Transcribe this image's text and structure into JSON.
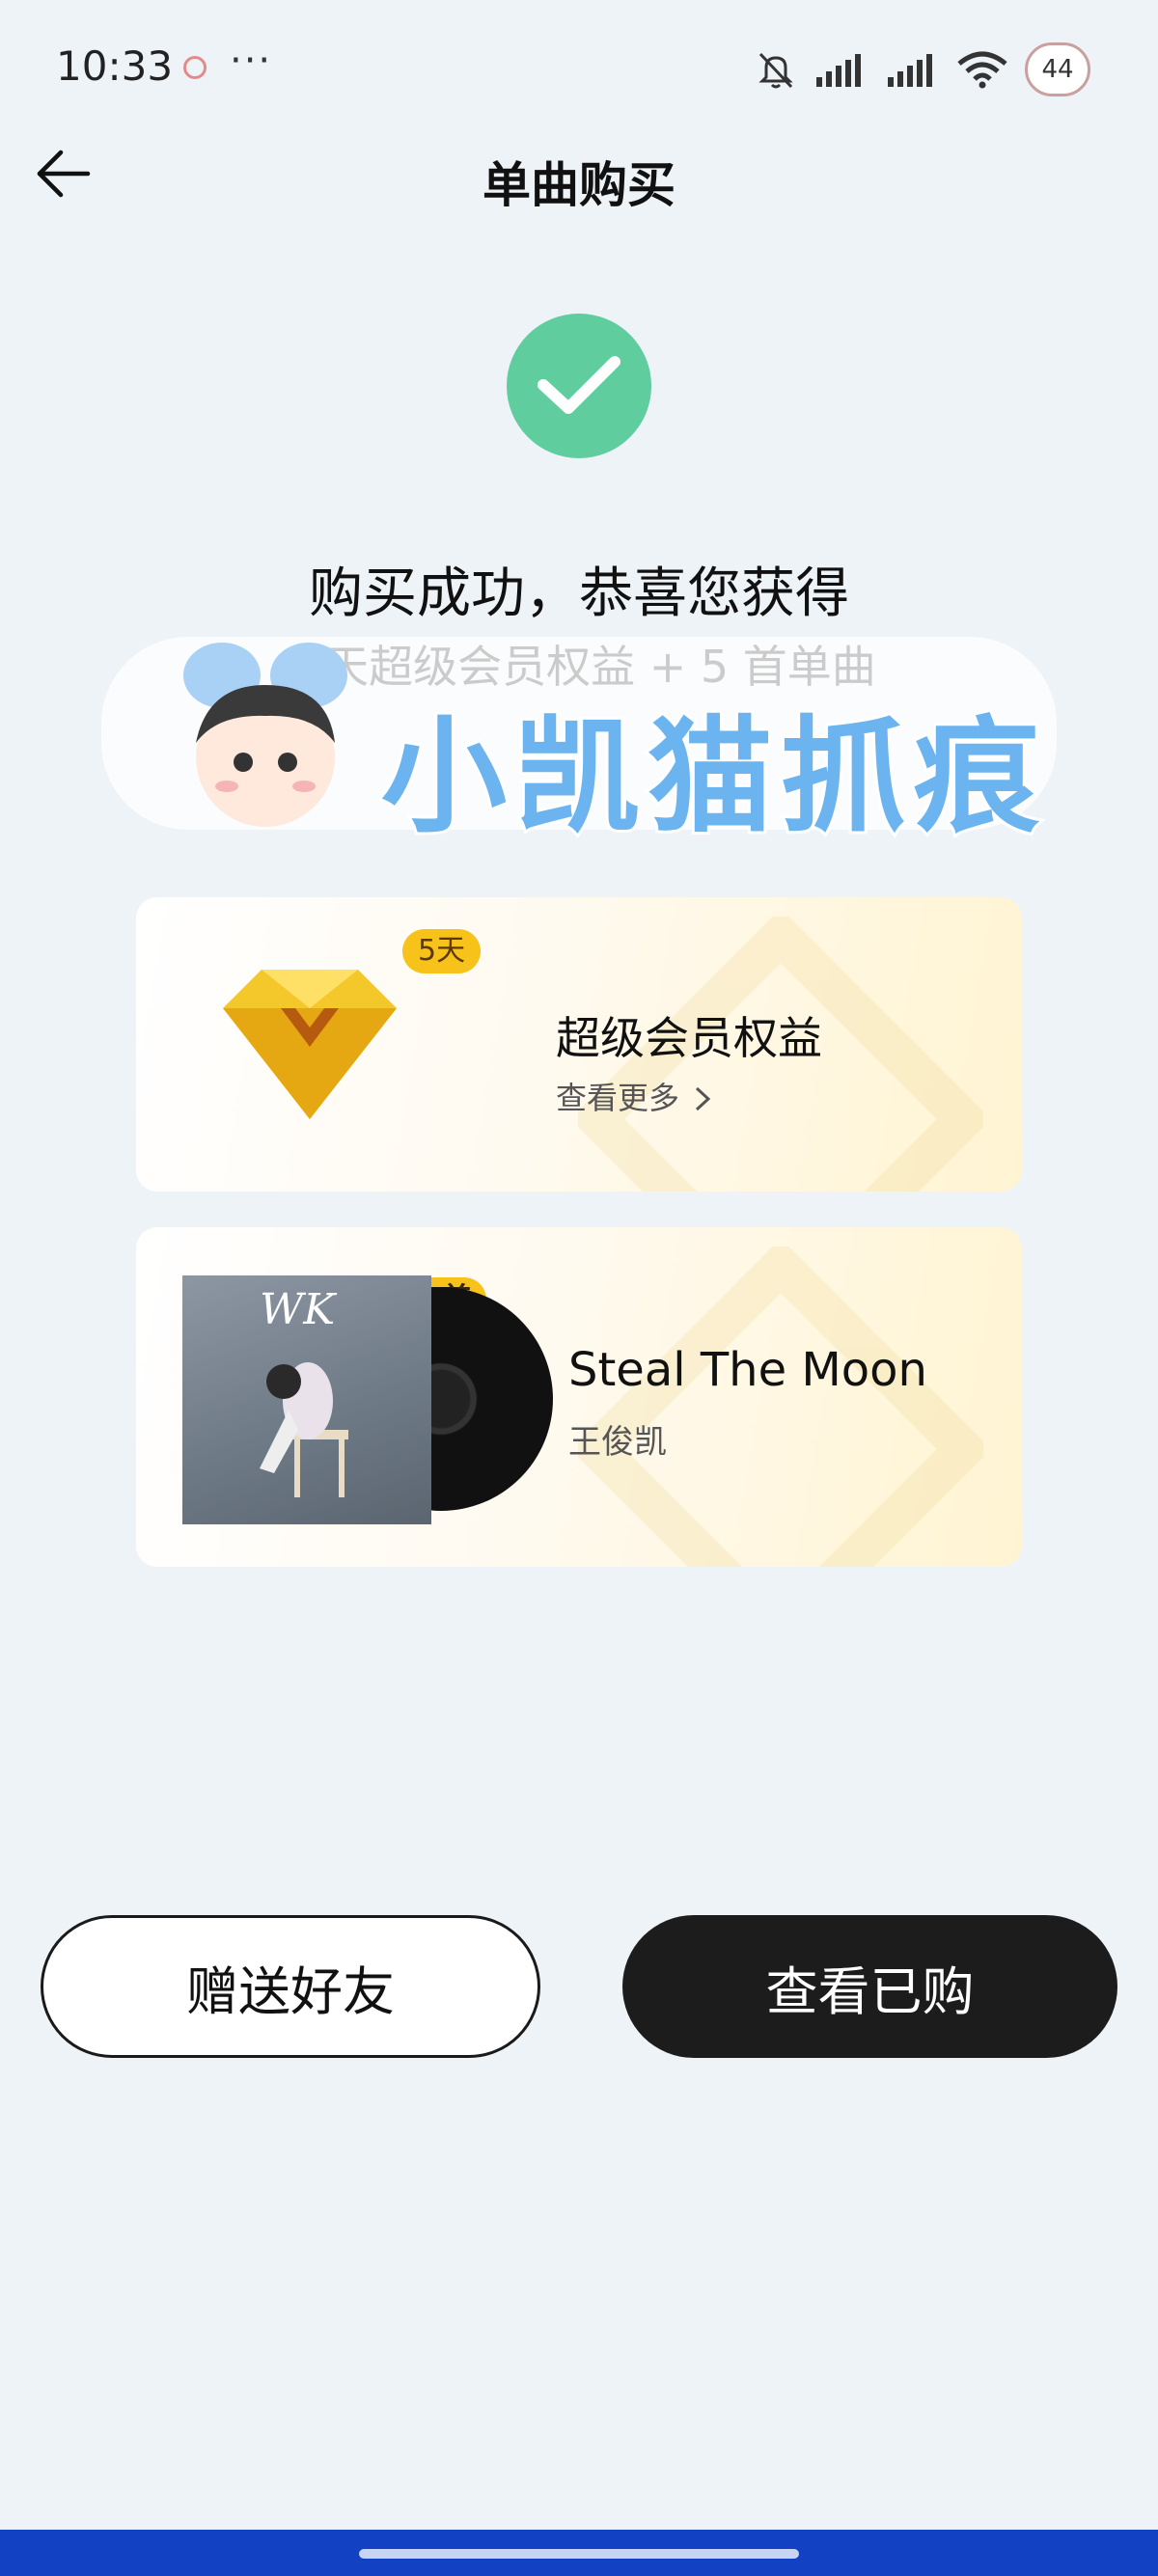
{
  "status_bar": {
    "time": "10:33",
    "dots": "···",
    "battery": "44"
  },
  "header": {
    "title": "单曲购买"
  },
  "success": {
    "title": "购买成功，恭喜您获得",
    "subtitle": "5 天超级会员权益 + 5 首单曲"
  },
  "watermark": {
    "sticker_text": "小凯猫抓痕"
  },
  "vip_card": {
    "badge": "5天",
    "title": "超级会员权益",
    "more_link": "查看更多",
    "more_icon": "chevron-right-icon"
  },
  "song_card": {
    "badge": "5首",
    "title": "Steal The Moon",
    "artist": "王俊凯"
  },
  "buttons": {
    "gift": "赠送好友",
    "view_purchased": "查看已购"
  },
  "colors": {
    "success_green": "#5fcd9e",
    "badge_yellow": "#f7c21a",
    "primary_button": "#1c1c1c",
    "nav_bar": "#1341c4"
  }
}
